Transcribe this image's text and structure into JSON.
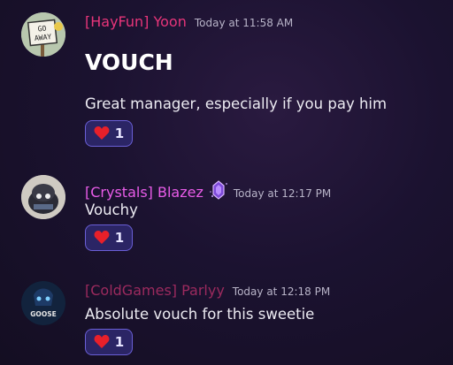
{
  "messages": [
    {
      "username": "[HayFun] Yoon",
      "username_color": "#e8357a",
      "timestamp": "Today at 11:58 AM",
      "content": "VOUCH",
      "content2": "Great manager, especially if you pay him",
      "avatar_sign_text": "GO AWAY",
      "reaction": {
        "icon": "heart-icon",
        "count": "1"
      }
    },
    {
      "username": "[Crystals] Blazez",
      "username_color": "#e85ce8",
      "timestamp": "Today at 12:17 PM",
      "content": "Vouchy",
      "badge_icon": "crystal-badge-icon",
      "reaction": {
        "icon": "heart-icon",
        "count": "1"
      }
    },
    {
      "username": "[ColdGames] Parlyy",
      "username_color": "#9c2a5e",
      "timestamp": "Today at 12:18 PM",
      "content": "Absolute vouch for this sweetie",
      "avatar_text": "GOOSE",
      "reaction": {
        "icon": "heart-icon",
        "count": "1"
      }
    }
  ]
}
